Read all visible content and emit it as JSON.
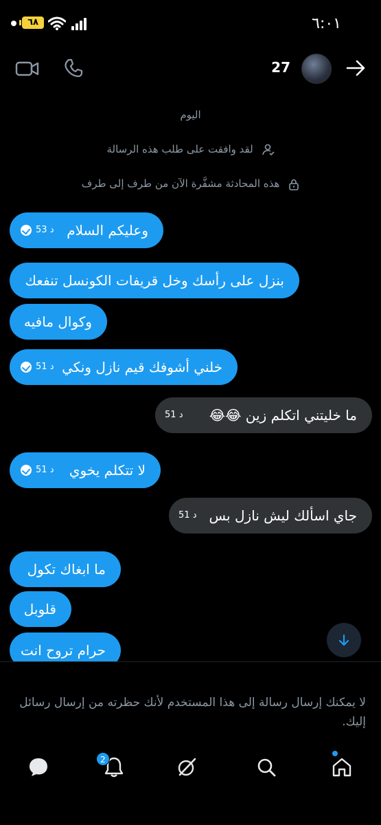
{
  "status_bar": {
    "time": "٦:٠١",
    "battery": "٦٨"
  },
  "header": {
    "contact_name": "27"
  },
  "date_label": "اليوم",
  "info": {
    "accepted": "لقد وافقت على طلب هذه الرسالة",
    "encrypted": "هذه المحادثة مشفَّرة الآن من طرف إلى طرف"
  },
  "messages": [
    {
      "direction": "sent",
      "text": "وعليكم السلام",
      "time": "53 د",
      "read": true
    },
    {
      "direction": "sent",
      "text": "بنزل على رأسك وخل قريفات الكونسل تنفعك",
      "time": "",
      "read": false
    },
    {
      "direction": "sent",
      "text": "وكوال مافيه",
      "time": "",
      "read": false
    },
    {
      "direction": "sent",
      "text": "خلني أشوفك قيم نازل ونكي",
      "time": "51 د",
      "read": true
    },
    {
      "direction": "received",
      "text": "ما خليتني اتكلم زين 😂😂",
      "time": "51 د"
    },
    {
      "direction": "sent",
      "text": "لا تتكلم يخوي",
      "time": "51 د",
      "read": true
    },
    {
      "direction": "received",
      "text": "جاي اسألك ليش نازل بس",
      "time": "51 د"
    },
    {
      "direction": "sent",
      "text": "ما ابغاك تكول",
      "time": "",
      "read": false
    },
    {
      "direction": "sent",
      "text": "قلوبل",
      "time": "",
      "read": false
    },
    {
      "direction": "sent",
      "text": "حرام تروح انت",
      "time": "",
      "read": false
    }
  ],
  "blocked_notice": "لا يمكنك إرسال رسالة إلى هذا المستخدم لأنك حظرته من إرسال رسائل إليك.",
  "bottom_nav": {
    "notifications_badge": "2",
    "items": [
      "messages-icon",
      "notifications-icon",
      "grok-icon",
      "search-icon",
      "home-icon"
    ]
  },
  "colors": {
    "accent": "#1d9bf0",
    "received_bubble": "#2f3336",
    "muted_text": "#8b98a5",
    "background": "#000000"
  }
}
